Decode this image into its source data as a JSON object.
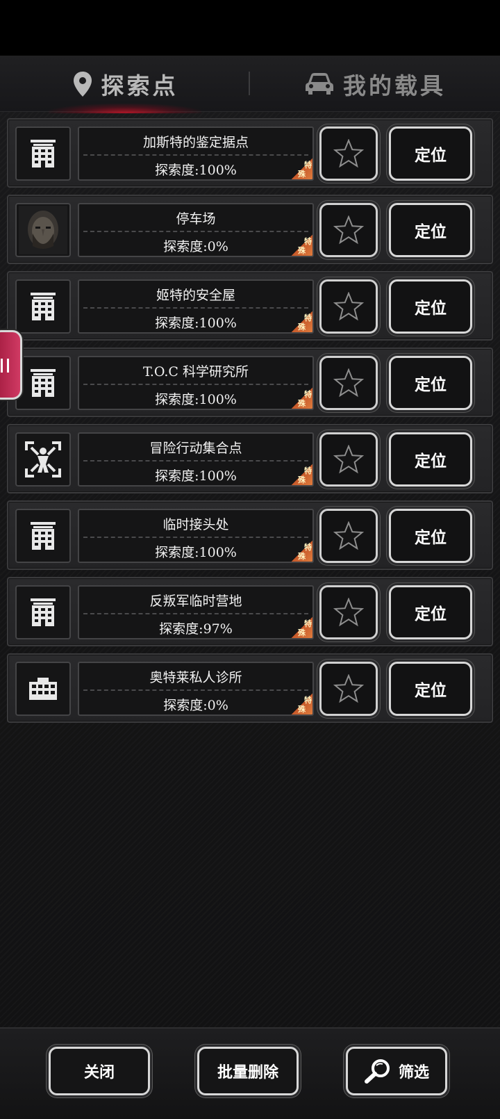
{
  "tabs": {
    "explore_label": "探索点",
    "vehicle_label": "我的载具"
  },
  "locations": [
    {
      "name": "加斯特的鉴定据点",
      "progress": "探索度:100%",
      "icon": "building-icon",
      "tag_line1": "特",
      "tag_line2": "殊",
      "locate_label": "定位"
    },
    {
      "name": "停车场",
      "progress": "探索度:0%",
      "icon": "portrait-icon",
      "tag_line1": "特",
      "tag_line2": "殊",
      "locate_label": "定位"
    },
    {
      "name": "姬特的安全屋",
      "progress": "探索度:100%",
      "icon": "building-icon",
      "tag_line1": "特",
      "tag_line2": "殊",
      "locate_label": "定位"
    },
    {
      "name": "T.O.C 科学研究所",
      "progress": "探索度:100%",
      "icon": "building-icon",
      "tag_line1": "特",
      "tag_line2": "殊",
      "locate_label": "定位"
    },
    {
      "name": "冒险行动集合点",
      "progress": "探索度:100%",
      "icon": "rally-point-icon",
      "tag_line1": "特",
      "tag_line2": "殊",
      "locate_label": "定位"
    },
    {
      "name": "临时接头处",
      "progress": "探索度:100%",
      "icon": "building-icon",
      "tag_line1": "特",
      "tag_line2": "殊",
      "locate_label": "定位"
    },
    {
      "name": "反叛军临时营地",
      "progress": "探索度:97%",
      "icon": "building-icon",
      "tag_line1": "特",
      "tag_line2": "殊",
      "locate_label": "定位"
    },
    {
      "name": "奥特莱私人诊所",
      "progress": "探索度:0%",
      "icon": "clinic-icon",
      "tag_line1": "特",
      "tag_line2": "殊",
      "locate_label": "定位"
    }
  ],
  "footer": {
    "close_label": "关闭",
    "batch_delete_label": "批量删除",
    "filter_label": "筛选"
  },
  "colors": {
    "accent_red": "#c8142a",
    "special_tag": "#d8703a"
  }
}
